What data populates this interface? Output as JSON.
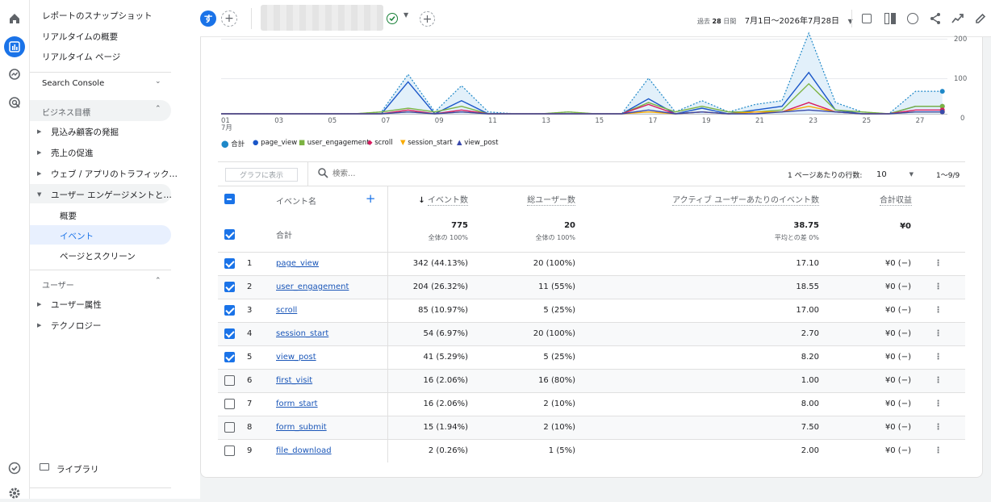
{
  "nav": {
    "top_items": [
      "レポートのスナップショット",
      "リアルタイムの概要",
      "リアルタイム ページ"
    ],
    "search_console": "Search Console",
    "business_goals": "ビジネス目標",
    "goal_items": [
      "見込み顧客の発掘",
      "売上の促進",
      "ウェブ / アプリのトラフィック…",
      "ユーザー エンゲージメントと…"
    ],
    "engagement_sub": [
      "概要",
      "イベント",
      "ページとスクリーン"
    ],
    "users_section": "ユーザー",
    "user_items": [
      "ユーザー属性",
      "テクノロジー"
    ],
    "library": "ライブラリ"
  },
  "topbar": {
    "avatar": "す",
    "date_prefix": "過去",
    "date_days": "28",
    "date_suffix": "日間",
    "date_range": "7月1日〜2026年7月28日"
  },
  "chart_data": {
    "type": "line",
    "x": [
      "01",
      "02",
      "03",
      "04",
      "05",
      "06",
      "07",
      "08",
      "09",
      "10",
      "11",
      "12",
      "13",
      "14",
      "15",
      "16",
      "17",
      "18",
      "19",
      "20",
      "21",
      "22",
      "23",
      "24",
      "25",
      "26",
      "27",
      "28"
    ],
    "x_tick_labels": [
      "01",
      "03",
      "05",
      "07",
      "09",
      "11",
      "13",
      "15",
      "17",
      "19",
      "21",
      "23",
      "25",
      "27"
    ],
    "x_sublabel": "7月",
    "y_ticks": [
      "0",
      "100",
      "200"
    ],
    "ylim": [
      0,
      200
    ],
    "series": [
      {
        "name": "合計",
        "color": "#1e88c8",
        "style": "dotted-area",
        "values": [
          0,
          0,
          0,
          0,
          0,
          0,
          5,
          105,
          5,
          75,
          5,
          0,
          0,
          5,
          0,
          0,
          95,
          5,
          35,
          5,
          25,
          35,
          215,
          30,
          5,
          0,
          60,
          60
        ]
      },
      {
        "name": "page_view",
        "color": "#1a56c8",
        "values": [
          0,
          0,
          0,
          0,
          0,
          0,
          0,
          85,
          0,
          35,
          0,
          0,
          0,
          0,
          0,
          0,
          40,
          0,
          15,
          0,
          10,
          20,
          110,
          10,
          0,
          0,
          20,
          20
        ]
      },
      {
        "name": "user_engagement",
        "color": "#7cb342",
        "values": [
          0,
          0,
          0,
          0,
          0,
          0,
          5,
          15,
          5,
          20,
          0,
          0,
          0,
          5,
          0,
          0,
          30,
          5,
          20,
          5,
          5,
          10,
          80,
          10,
          5,
          0,
          20,
          20
        ]
      },
      {
        "name": "scroll",
        "color": "#d81b60",
        "values": [
          0,
          0,
          0,
          0,
          0,
          0,
          0,
          10,
          0,
          10,
          0,
          0,
          0,
          0,
          0,
          0,
          25,
          0,
          5,
          0,
          5,
          5,
          30,
          5,
          0,
          0,
          10,
          10
        ]
      },
      {
        "name": "session_start",
        "color": "#f9ab00",
        "values": [
          0,
          0,
          0,
          0,
          0,
          0,
          0,
          5,
          0,
          5,
          0,
          0,
          0,
          0,
          0,
          0,
          5,
          0,
          5,
          0,
          5,
          5,
          20,
          5,
          0,
          0,
          5,
          5
        ]
      },
      {
        "name": "view_post",
        "color": "#3949ab",
        "values": [
          0,
          0,
          0,
          0,
          0,
          0,
          0,
          5,
          0,
          5,
          0,
          0,
          0,
          0,
          0,
          0,
          10,
          0,
          5,
          0,
          0,
          5,
          10,
          5,
          0,
          0,
          5,
          5
        ]
      }
    ]
  },
  "table": {
    "graph_button": "グラフに表示",
    "search_placeholder": "検索…",
    "rows_per_page_label": "1 ページあたりの行数:",
    "rows_per_page": "10",
    "pagination": "1〜9/9",
    "headers": {
      "event_name": "イベント名",
      "event_count": "イベント数",
      "total_users": "総ユーザー数",
      "events_per_user": "アクティブ ユーザーあたりのイベント数",
      "revenue": "合計収益"
    },
    "totals": {
      "label": "合計",
      "event_count": "775",
      "event_count_sub": "全体の 100%",
      "total_users": "20",
      "total_users_sub": "全体の 100%",
      "events_per_user": "38.75",
      "events_per_user_sub": "平均との差 0%",
      "revenue": "¥0"
    },
    "rows": [
      {
        "idx": "1",
        "name": "page_view",
        "count": "342 (44.13%)",
        "users": "20 (100%)",
        "epu": "17.10",
        "rev": "¥0 (−)",
        "checked": true
      },
      {
        "idx": "2",
        "name": "user_engagement",
        "count": "204 (26.32%)",
        "users": "11 (55%)",
        "epu": "18.55",
        "rev": "¥0 (−)",
        "checked": true
      },
      {
        "idx": "3",
        "name": "scroll",
        "count": "85 (10.97%)",
        "users": "5 (25%)",
        "epu": "17.00",
        "rev": "¥0 (−)",
        "checked": true
      },
      {
        "idx": "4",
        "name": "session_start",
        "count": "54 (6.97%)",
        "users": "20 (100%)",
        "epu": "2.70",
        "rev": "¥0 (−)",
        "checked": true
      },
      {
        "idx": "5",
        "name": "view_post",
        "count": "41 (5.29%)",
        "users": "5 (25%)",
        "epu": "8.20",
        "rev": "¥0 (−)",
        "checked": true
      },
      {
        "idx": "6",
        "name": "first_visit",
        "count": "16 (2.06%)",
        "users": "16 (80%)",
        "epu": "1.00",
        "rev": "¥0 (−)",
        "checked": false
      },
      {
        "idx": "7",
        "name": "form_start",
        "count": "16 (2.06%)",
        "users": "2 (10%)",
        "epu": "8.00",
        "rev": "¥0 (−)",
        "checked": false
      },
      {
        "idx": "8",
        "name": "form_submit",
        "count": "15 (1.94%)",
        "users": "2 (10%)",
        "epu": "7.50",
        "rev": "¥0 (−)",
        "checked": false
      },
      {
        "idx": "9",
        "name": "file_download",
        "count": "2 (0.26%)",
        "users": "1 (5%)",
        "epu": "2.00",
        "rev": "¥0 (−)",
        "checked": false
      }
    ]
  }
}
